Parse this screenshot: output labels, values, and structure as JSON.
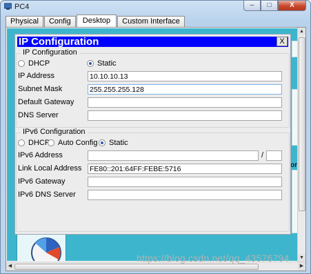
{
  "window": {
    "title": "PC4",
    "buttons": {
      "minimize": "–",
      "maximize": "□",
      "close": "X"
    }
  },
  "tabs": [
    {
      "label": "Physical"
    },
    {
      "label": "Config"
    },
    {
      "label": "Desktop",
      "active": true
    },
    {
      "label": "Custom Interface"
    }
  ],
  "desktop": {
    "background_color": "#3db6cd",
    "partial_label": "or"
  },
  "dialog": {
    "title": "IP Configuration",
    "close_label": "X",
    "ipv4": {
      "group_label": "IP Configuration",
      "mode_options": [
        "DHCP",
        "Static"
      ],
      "selected_mode": "Static",
      "fields": {
        "ip_address": {
          "label": "IP Address",
          "value": "10.10.10.13"
        },
        "subnet_mask": {
          "label": "Subnet Mask",
          "value": "255.255.255.128"
        },
        "default_gateway": {
          "label": "Default Gateway",
          "value": ""
        },
        "dns_server": {
          "label": "DNS Server",
          "value": ""
        }
      }
    },
    "ipv6": {
      "group_label": "IPv6 Configuration",
      "mode_options": [
        "DHCP",
        "Auto Config",
        "Static"
      ],
      "selected_mode": "Static",
      "fields": {
        "ipv6_address": {
          "label": "IPv6 Address",
          "value": "",
          "prefix": ""
        },
        "link_local": {
          "label": "Link Local Address",
          "value": "FE80::201:64FF:FEBE:5716"
        },
        "ipv6_gateway": {
          "label": "IPv6 Gateway",
          "value": ""
        },
        "ipv6_dns": {
          "label": "IPv6 DNS Server",
          "value": ""
        }
      },
      "prefix_separator": "/"
    }
  },
  "watermark": "https://blog.csdn.net/qq_43576794",
  "colors": {
    "dialog_title_bg": "#0000ff",
    "radio_selected": "#2a5aa8"
  }
}
